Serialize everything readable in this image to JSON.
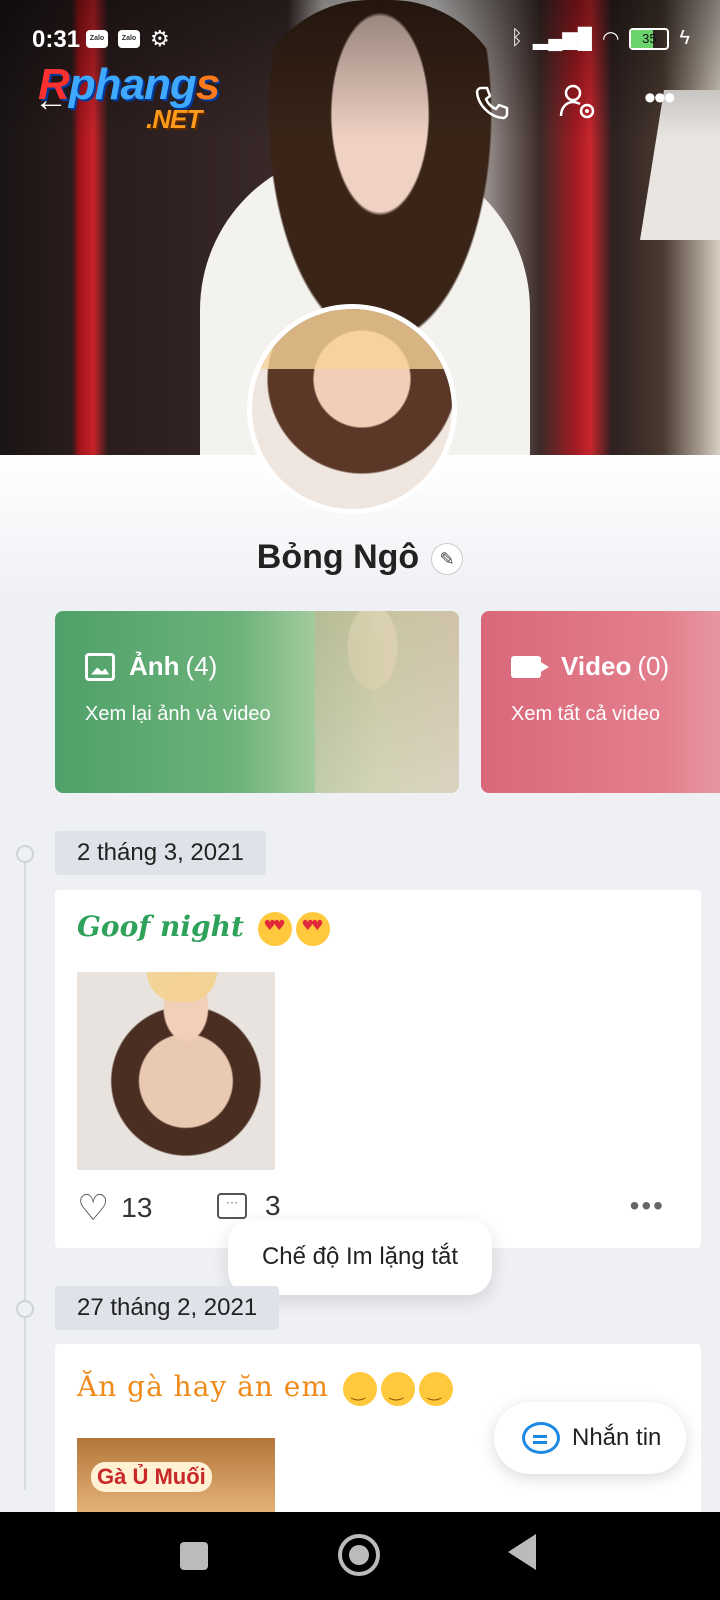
{
  "status_bar": {
    "time": "0:31",
    "app_badge_1": "Zalo",
    "app_badge_2": "Zalo",
    "battery": "35"
  },
  "watermark": {
    "brand": "Rphangs",
    "domain": ".NET"
  },
  "colors": {
    "accent_blue": "#1e88e5",
    "photos_card": "#4fa06a",
    "video_card": "#d9677a",
    "post1_text": "#2ea15a",
    "post2_text": "#f08a1a"
  },
  "icons": {
    "back": "back-arrow-icon",
    "call": "phone-icon",
    "settings": "user-settings-icon",
    "more": "more-dots-icon"
  },
  "profile": {
    "name": "Bỏng Ngô"
  },
  "cards": {
    "photos": {
      "label": "Ảnh",
      "count": "(4)",
      "subtitle": "Xem lại ảnh và video"
    },
    "video": {
      "label": "Video",
      "count": "(0)",
      "subtitle": "Xem tất cả video"
    }
  },
  "posts": [
    {
      "date": "2 tháng 3, 2021",
      "text": "Goof night",
      "likes": "13",
      "comments": "3"
    },
    {
      "date": "27 tháng 2, 2021",
      "text": "Ăn gà hay ăn em",
      "image_sign": "Gà Ủ Muối"
    }
  ],
  "tooltip": "Chế độ Im lặng tắt",
  "fab": {
    "label": "Nhắn tin"
  }
}
